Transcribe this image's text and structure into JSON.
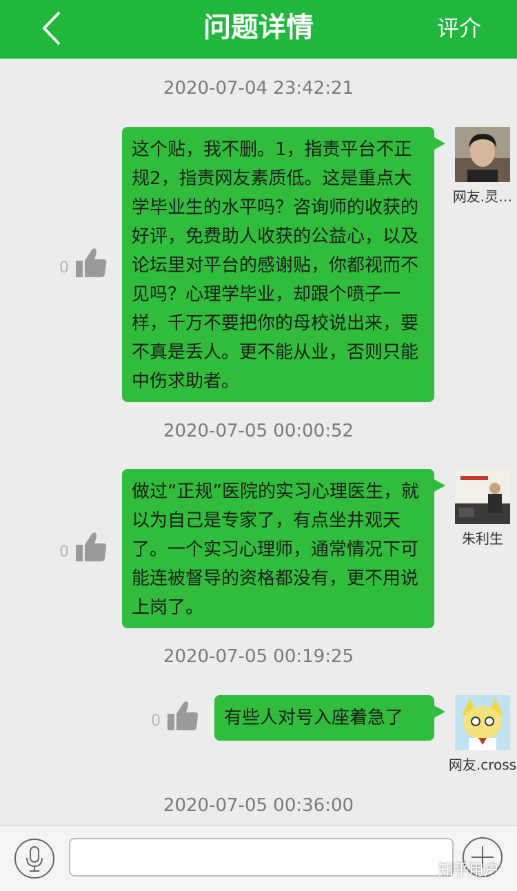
{
  "header": {
    "title": "问题详情",
    "action_label": "评介",
    "back_icon": "chevron-left-icon",
    "color": "#1fb83a"
  },
  "messages": [
    {
      "timestamp": "2020-07-04 23:42:21",
      "text": "这个贴，我不删。1，指责平台不正规2，指责网友素质低。这是重点大学毕业生的水平吗？咨询师的收获的好评，免费助人收获的公益心，以及论坛里对平台的感谢贴，你都视而不见吗？心理学毕业，却跟个喷子一样，千万不要把你的母校说出来，要不真是丢人。更不能从业，否则只能中伤求助者。",
      "likes": "0",
      "author": "网友.灵…"
    },
    {
      "timestamp": "2020-07-05 00:00:52",
      "text": "做过“正规”医院的实习心理医生，就以为自己是专家了，有点坐井观天了。一个实习心理师，通常情况下可能连被督导的资格都没有，更不用说上岗了。",
      "likes": "0",
      "author": "朱利生"
    },
    {
      "timestamp": "2020-07-05 00:19:25",
      "text": "有些人对号入座着急了",
      "likes": "0",
      "author": "网友.cross"
    },
    {
      "timestamp": "2020-07-05 00:36:00"
    }
  ],
  "input_bar": {
    "placeholder": "",
    "mic_icon": "microphone-icon",
    "plus_icon": "plus-circle-icon"
  },
  "watermark": "知乎用户",
  "colors": {
    "bubble": "#2fbd3b",
    "background": "#ececec"
  }
}
